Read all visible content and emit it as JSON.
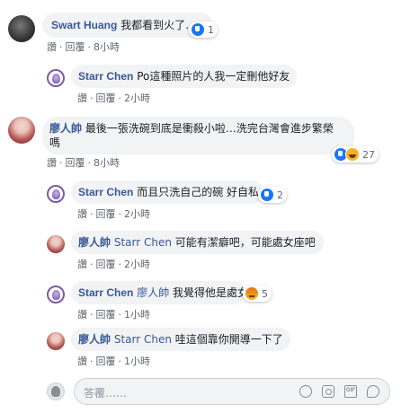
{
  "comments": [
    {
      "author": "Swart Huang",
      "text": "我都看到火了…",
      "reaction_count": "1",
      "actions": {
        "like": "讚",
        "reply": "回覆",
        "time": "8小時"
      }
    },
    {
      "author": "Starr Chen",
      "text": "Po這種照片的人我一定刪他好友",
      "actions": {
        "like": "讚",
        "reply": "回覆",
        "time": "2小時"
      }
    },
    {
      "author": "廖人帥",
      "text_line1": "最後一張洗碗到底是衝殺小啦…洗完台灣會進步繁榮",
      "text_line2": "嗎",
      "reaction_count": "27",
      "actions": {
        "like": "讚",
        "reply": "回覆",
        "time": "8小時"
      }
    },
    {
      "author": "Starr Chen",
      "text": "而且只洗自己的碗 好自私",
      "reaction_count": "2",
      "actions": {
        "like": "讚",
        "reply": "回覆",
        "time": "2小時"
      }
    },
    {
      "author": "廖人帥",
      "tag": "Starr Chen",
      "text": "可能有潔癖吧，可能處女座吧",
      "actions": {
        "like": "讚",
        "reply": "回覆",
        "time": "2小時"
      }
    },
    {
      "author": "Starr Chen",
      "tag": "廖人帥",
      "text": "我覺得他是處女",
      "reaction_count": "5",
      "actions": {
        "like": "讚",
        "reply": "回覆",
        "time": "1小時"
      }
    },
    {
      "author": "廖人帥",
      "tag": "Starr Chen",
      "text": "哇這個靠你開導一下了",
      "actions": {
        "like": "讚",
        "reply": "回覆",
        "time": "1小時"
      }
    }
  ],
  "reply_box": {
    "placeholder": "答覆……"
  },
  "icons": {
    "like": "like-icon",
    "haha": "haha-icon",
    "angry": "angry-icon",
    "emoji": "emoji-icon",
    "camera": "camera-icon",
    "gif": "gif-icon",
    "sticker": "sticker-icon"
  },
  "colors": {
    "name": "#385898",
    "bubble": "#f2f3f5",
    "like": "#1877f2"
  }
}
